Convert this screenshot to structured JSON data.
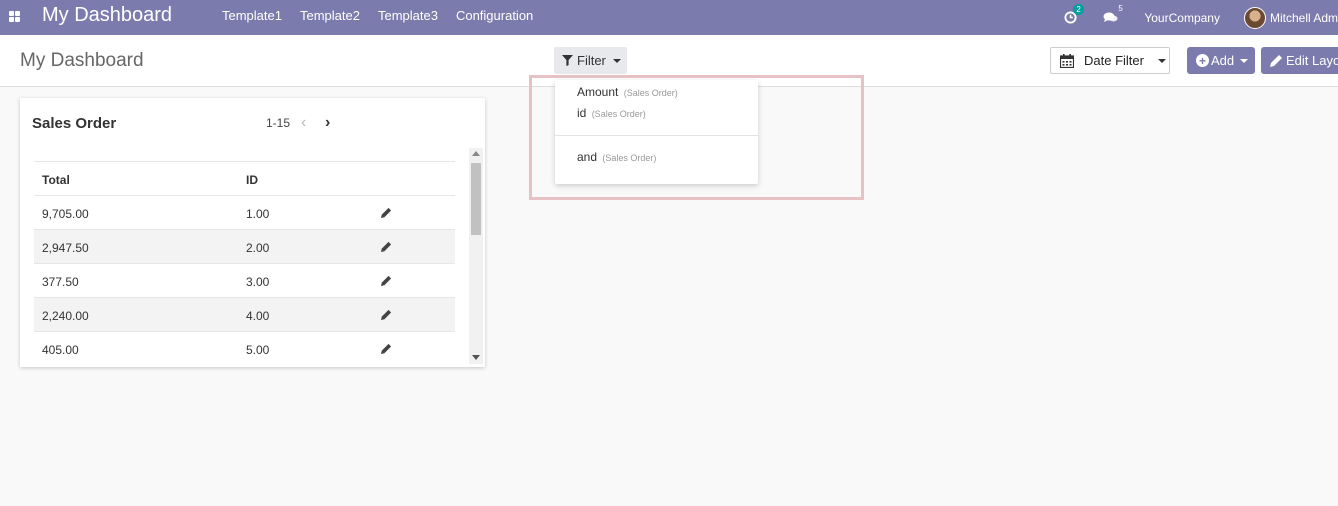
{
  "navbar": {
    "apps_icon": "apps-grid-icon",
    "brand": "My Dashboard",
    "menu": [
      "Template1",
      "Template2",
      "Template3",
      "Configuration"
    ],
    "activity_count": "2",
    "messages_count": "5",
    "company": "YourCompany",
    "user": "Mitchell Adm"
  },
  "control_panel": {
    "title": "My Dashboard",
    "filter_label": "Filter",
    "date_filter_label": "Date Filter",
    "add_label": "Add",
    "edit_layout_label": "Edit Layout"
  },
  "filter_dropdown": {
    "items": [
      {
        "label": "Amount",
        "model": "(Sales Order)"
      },
      {
        "label": "id",
        "model": "(Sales Order)"
      },
      {
        "label": "and",
        "model": "(Sales Order)"
      }
    ]
  },
  "card": {
    "title": "Sales Order",
    "pager": "1-15",
    "columns": [
      "Total",
      "ID"
    ],
    "rows": [
      {
        "total": "9,705.00",
        "id": "1.00"
      },
      {
        "total": "2,947.50",
        "id": "2.00"
      },
      {
        "total": "377.50",
        "id": "3.00"
      },
      {
        "total": "2,240.00",
        "id": "4.00"
      },
      {
        "total": "405.00",
        "id": "5.00"
      }
    ]
  },
  "colors": {
    "navbar": "#7c7bad",
    "primary_button": "#7c7bad",
    "badge": "#00a09d",
    "highlight": "#e6c2c5"
  }
}
